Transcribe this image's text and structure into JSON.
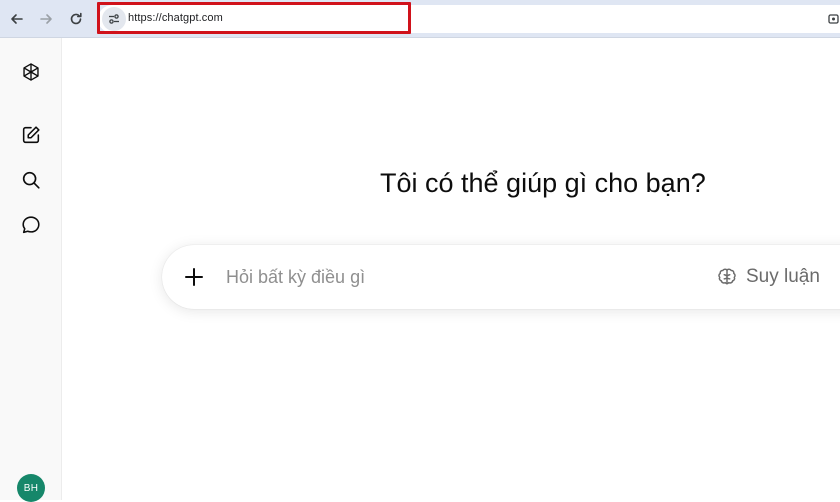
{
  "browser": {
    "url": "https://chatgpt.com",
    "icons": {
      "back": "arrow-left-icon",
      "forward": "arrow-right-icon",
      "reload": "reload-icon",
      "site_info": "tune-icon",
      "extension": "puzzle-icon"
    },
    "highlight_color": "#d0121b"
  },
  "sidebar": {
    "icons": [
      "chatgpt-logo-icon",
      "new-chat-icon",
      "search-icon",
      "chat-bubble-icon"
    ],
    "avatar_initials": "BH",
    "avatar_color": "#16876a"
  },
  "main": {
    "headline": "Tôi có thể giúp gì cho bạn?",
    "composer": {
      "placeholder": "Hỏi bất kỳ điều gì",
      "value": "",
      "attach_icon": "plus-icon",
      "reason_label": "Suy luận",
      "reason_icon": "brain-icon"
    }
  }
}
